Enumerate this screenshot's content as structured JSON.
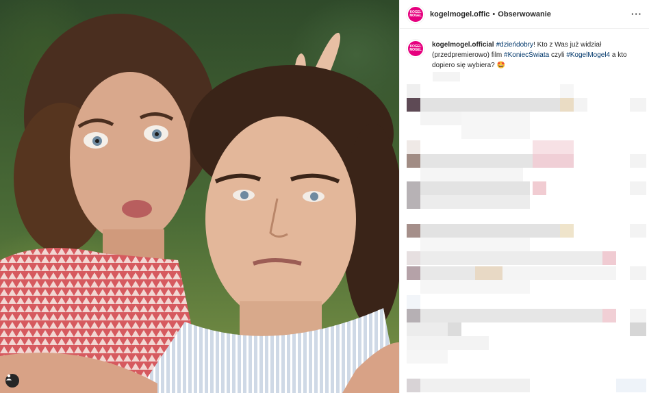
{
  "post": {
    "username": "kogelmogel.official",
    "header_username": "kogelmogel.offic",
    "separator": "•",
    "follow_label": "Obserwowanie",
    "more_label": "···",
    "avatar_text_top": "KOGEL",
    "avatar_text_bottom": "MOGEL",
    "caption": {
      "hashtag1": "#dzieńdobry",
      "text1": "! Kto z Was już widział (przedpremierowo) film ",
      "hashtag2": "#KoniecŚwiata",
      "text2": " czyli ",
      "hashtag3": "#KogelMogel4",
      "text3": " a kto dopiero się wybiera? ",
      "emoji": "🤩"
    }
  },
  "icons": {
    "tagged_people": "user-icon",
    "more": "ellipsis-icon"
  },
  "colors": {
    "brand": "#e6007e",
    "hashtag": "#00376b",
    "text": "#262626",
    "divider": "#efefef"
  }
}
